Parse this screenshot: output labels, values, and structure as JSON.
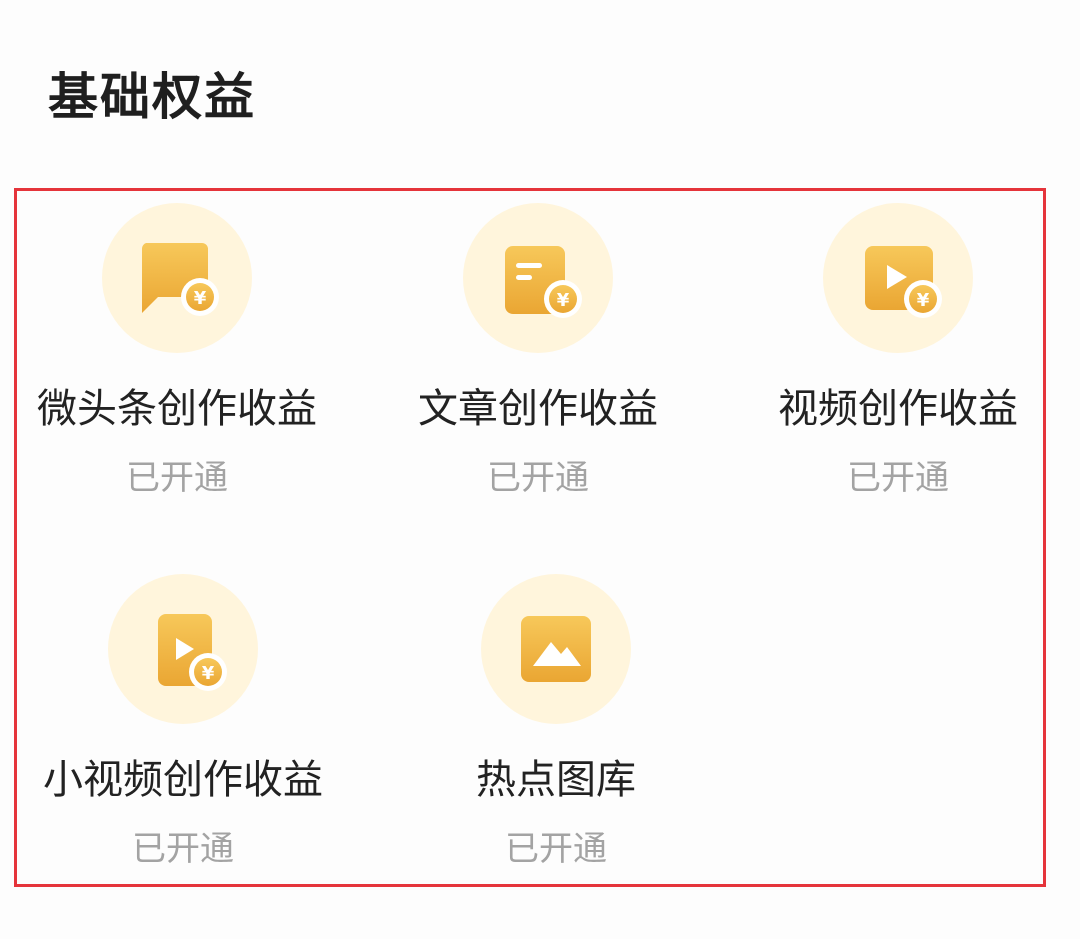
{
  "section": {
    "title": "基础权益"
  },
  "colors": {
    "frame": "#e5343b",
    "icon_bg": "#fff5dc",
    "icon_gold": "#f0b33f",
    "status_text": "#a3a3a3"
  },
  "benefits": [
    {
      "name": "微头条创作收益",
      "status": "已开通",
      "icon": "chat-bubble-coin-icon"
    },
    {
      "name": "文章创作收益",
      "status": "已开通",
      "icon": "document-coin-icon"
    },
    {
      "name": "视频创作收益",
      "status": "已开通",
      "icon": "video-coin-icon"
    },
    {
      "name": "小视频创作收益",
      "status": "已开通",
      "icon": "short-video-coin-icon"
    },
    {
      "name": "热点图库",
      "status": "已开通",
      "icon": "image-gallery-icon"
    }
  ]
}
